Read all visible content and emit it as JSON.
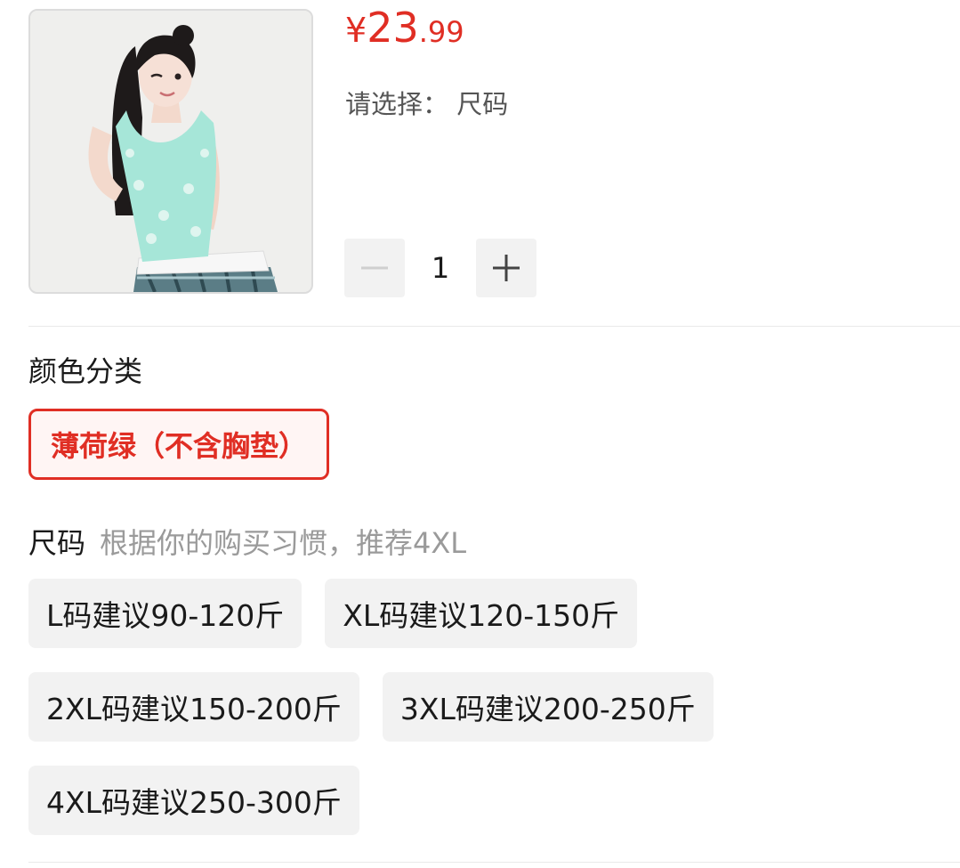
{
  "product": {
    "image_icon": "product-photo",
    "price_currency": "¥",
    "price_integer": "23",
    "price_decimal": ".99",
    "select_hint": "请选择： 尺码"
  },
  "quantity": {
    "minus_icon": "minus-icon",
    "value": "1",
    "plus_icon": "plus-icon"
  },
  "color_section": {
    "title": "颜色分类",
    "options": [
      {
        "label": "薄荷绿（不含胸垫）",
        "selected": true
      }
    ]
  },
  "size_section": {
    "title": "尺码",
    "recommendation": "根据你的购买习惯，推荐4XL",
    "options": [
      {
        "label": "L码建议90-120斤"
      },
      {
        "label": "XL码建议120-150斤"
      },
      {
        "label": "2XL码建议150-200斤"
      },
      {
        "label": "3XL码建议200-250斤"
      },
      {
        "label": "4XL码建议250-300斤"
      }
    ]
  },
  "colors": {
    "accent": "#e02e24",
    "chip_bg": "#f2f2f2",
    "muted_text": "#9a9a9a"
  }
}
